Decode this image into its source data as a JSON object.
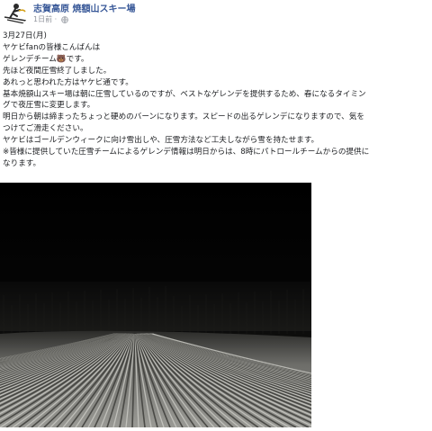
{
  "header": {
    "page_name": "志賀高原 焼額山スキー場",
    "timestamp": "1日前",
    "separator": "·",
    "privacy_icon": "globe-icon",
    "avatar_icon": "skier-icon"
  },
  "post": {
    "lines": [
      "3月27日(月)",
      "ヤケビfanの皆様こんばんは",
      "ゲレンデチーム🐻です。",
      "先ほど夜間圧雪終了しました。",
      "あれっと思われた方はヤケビ通です。",
      "基本焼額山スキー場は朝に圧雪しているのですが、ベストなゲレンデを提供するため、春になるタイミン",
      "グで夜圧雪に変更します。",
      "明日から朝は締まったちょっと硬めのバーンになります。スピードの出るゲレンデになりますので、気を",
      "つけてご滑走ください。",
      "ヤケビはゴールデンウィークに向け雪出しや、圧雪方法など工夫しながら雪を持たせます。",
      "※皆様に提供していた圧雪チームによるゲレンデ情報は明日からは、8時にパトロールチームからの提供に",
      "なります。"
    ]
  },
  "photo": {
    "subject": "night-groomed-ski-slope-image"
  },
  "colors": {
    "link": "#385898",
    "meta": "#90949c",
    "text": "#1c1e21"
  }
}
